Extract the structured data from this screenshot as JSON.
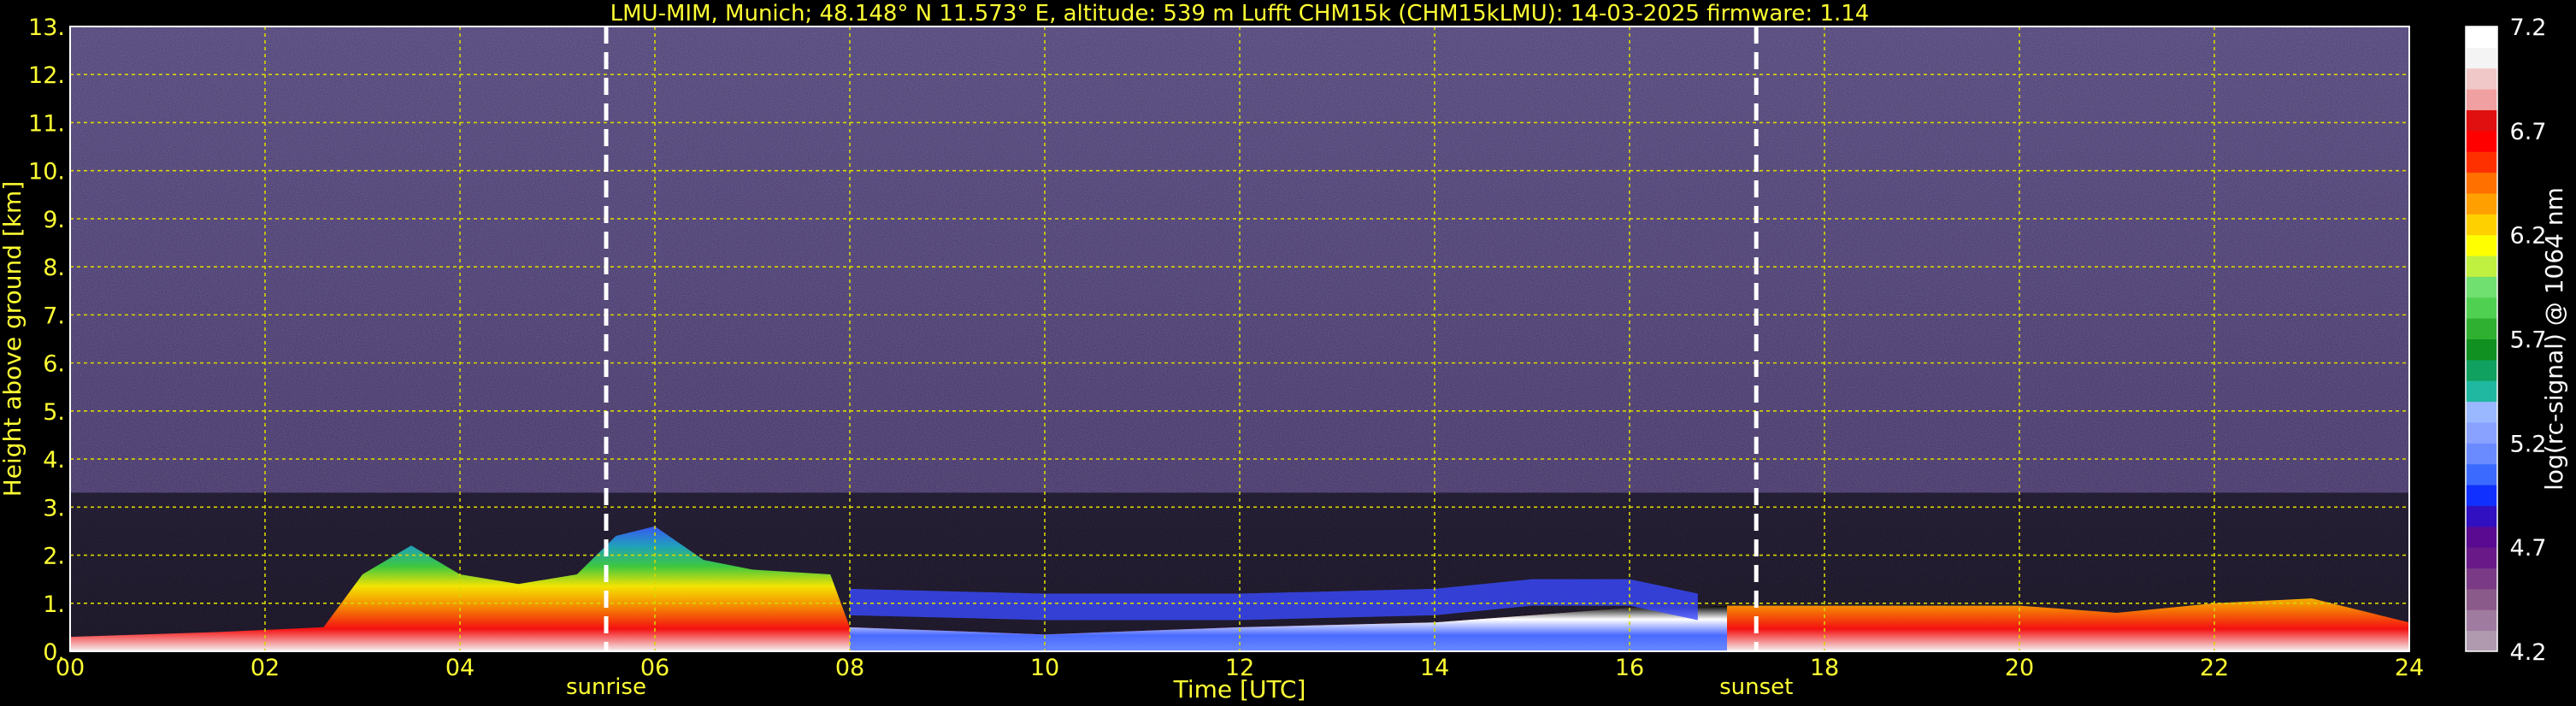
{
  "chart_data": {
    "type": "heatmap",
    "title": "LMU-MIM, Munich; 48.148° N 11.573° E, altitude: 539 m    Lufft CHM15k (CHM15kLMU): 14-03-2025    firmware: 1.14",
    "xlabel": "Time [UTC]",
    "ylabel": "Height above ground [km]",
    "xlim": [
      0,
      24
    ],
    "ylim": [
      0,
      13
    ],
    "xticks": [
      "00",
      "02",
      "04",
      "06",
      "08",
      "10",
      "12",
      "14",
      "16",
      "18",
      "20",
      "22",
      "24"
    ],
    "yticks": [
      "0.",
      "1.",
      "2.",
      "3.",
      "4.",
      "5.",
      "6.",
      "7.",
      "8.",
      "9.",
      "10.",
      "11.",
      "12.",
      "13."
    ],
    "grid": true,
    "sun_events": [
      {
        "label": "sunrise",
        "time": 5.5
      },
      {
        "label": "sunset",
        "time": 17.3
      }
    ],
    "colorbar": {
      "label": "log(rc-signal) @ 1064 nm",
      "range": [
        4.2,
        7.2
      ],
      "ticks": [
        "4.2",
        "4.7",
        "5.2",
        "5.7",
        "6.2",
        "6.7",
        "7.2"
      ],
      "colors": [
        "#b09ab0",
        "#a07ba0",
        "#8a5a8a",
        "#7a3a85",
        "#6a1a88",
        "#5a0a90",
        "#3010c0",
        "#1030ff",
        "#3a6aff",
        "#6a8aff",
        "#8aa2ff",
        "#9ab8ff",
        "#20b8a0",
        "#10a060",
        "#109020",
        "#30b030",
        "#50d050",
        "#70e070",
        "#c0f040",
        "#ffff00",
        "#ffd000",
        "#ffa000",
        "#ff7000",
        "#ff3000",
        "#ff0000",
        "#e01010",
        "#f0a0a0",
        "#f0c8c8",
        "#f4f4f4",
        "#ffffff"
      ]
    },
    "boundary_layer_top_km": [
      [
        0.0,
        0.3
      ],
      [
        1.5,
        0.4
      ],
      [
        2.6,
        0.5
      ],
      [
        3.0,
        1.6
      ],
      [
        3.5,
        2.2
      ],
      [
        4.0,
        1.6
      ],
      [
        4.6,
        1.4
      ],
      [
        5.2,
        1.6
      ],
      [
        5.6,
        2.4
      ],
      [
        6.0,
        2.6
      ],
      [
        6.5,
        1.9
      ],
      [
        7.0,
        1.7
      ],
      [
        7.8,
        1.6
      ],
      [
        8.0,
        0.5
      ],
      [
        10.0,
        0.35
      ],
      [
        12.0,
        0.5
      ],
      [
        14.0,
        0.6
      ],
      [
        16.0,
        0.9
      ],
      [
        17.0,
        0.95
      ],
      [
        18.0,
        0.95
      ],
      [
        20.0,
        0.95
      ],
      [
        21.0,
        0.8
      ],
      [
        22.0,
        1.0
      ],
      [
        23.0,
        1.1
      ],
      [
        24.0,
        0.6
      ]
    ],
    "aerosol_layer_km": [
      [
        8.0,
        1.3
      ],
      [
        10.0,
        1.2
      ],
      [
        12.0,
        1.2
      ],
      [
        14.0,
        1.3
      ],
      [
        15.0,
        1.5
      ],
      [
        16.0,
        1.5
      ],
      [
        16.7,
        1.2
      ]
    ]
  }
}
